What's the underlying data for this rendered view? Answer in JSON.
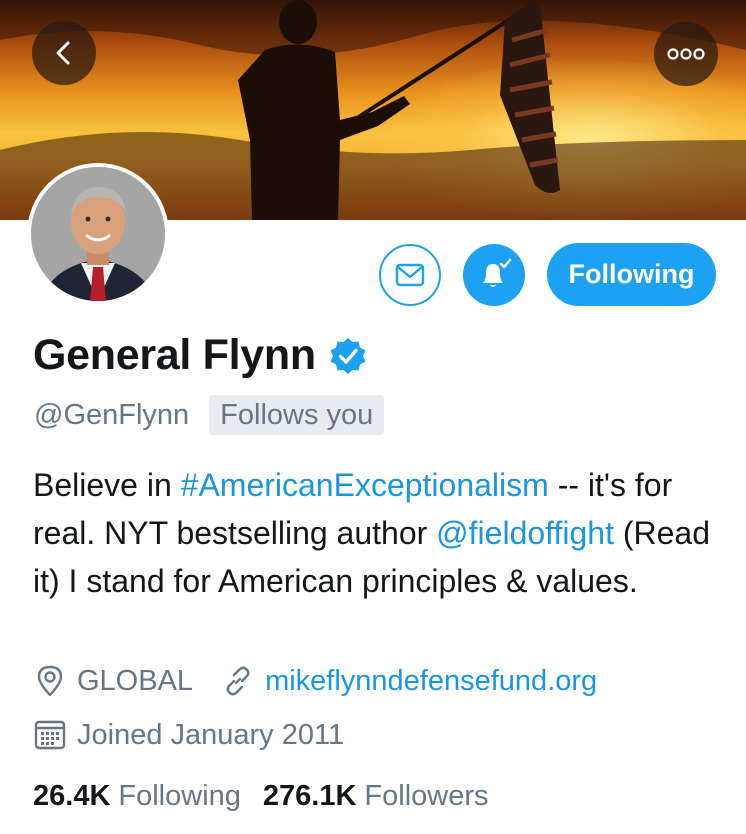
{
  "profile": {
    "name": "General Flynn",
    "handle": "@GenFlynn",
    "follows_you": "Follows you",
    "bio": {
      "t1": "Believe in ",
      "hashtag": "#AmericanExceptionalism",
      "t2": " -- it's for real. NYT bestselling author ",
      "mention": "@fieldoffight",
      "t3": " (Read it) I stand for American principles & values."
    },
    "location": "GLOBAL",
    "website": "mikeflynndefensefund.org",
    "joined": "Joined January 2011"
  },
  "actions": {
    "following_label": "Following"
  },
  "stats": {
    "following_count": "26.4K",
    "following_label": "Following",
    "followers_count": "276.1K",
    "followers_label": "Followers"
  },
  "icons": {
    "back": "chevron-left-icon",
    "more": "more-dots-icon",
    "message": "envelope-icon",
    "notifications": "bell-check-icon",
    "verified": "verified-badge-icon",
    "location": "location-pin-icon",
    "website": "link-icon",
    "joined": "calendar-icon"
  },
  "colors": {
    "accent": "#1da1f2",
    "link": "#1b95e0",
    "secondary_text": "#657786",
    "primary_text": "#14171a"
  }
}
